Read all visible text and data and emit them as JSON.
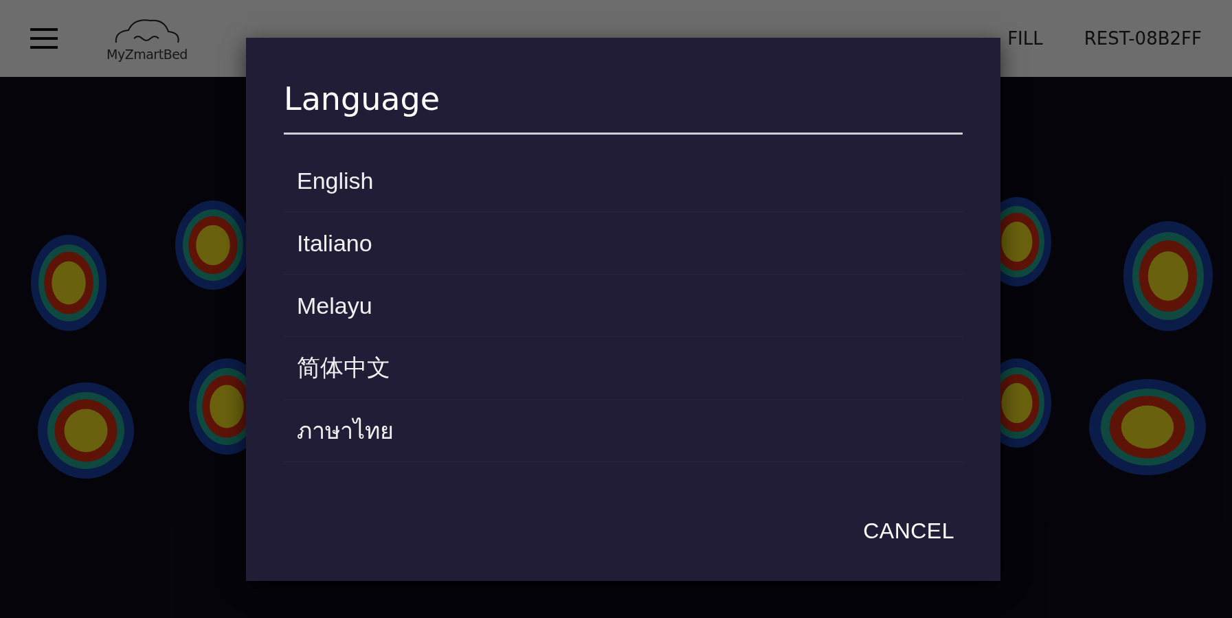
{
  "header": {
    "brand": "MyZmartBed",
    "fill": "FILL",
    "device": "REST-08B2FF"
  },
  "dialog": {
    "title": "Language",
    "options": [
      {
        "label": "English"
      },
      {
        "label": "Italiano"
      },
      {
        "label": "Melayu"
      },
      {
        "label": "简体中文"
      },
      {
        "label": "ภาษาไทย"
      }
    ],
    "cancel": "CANCEL"
  }
}
